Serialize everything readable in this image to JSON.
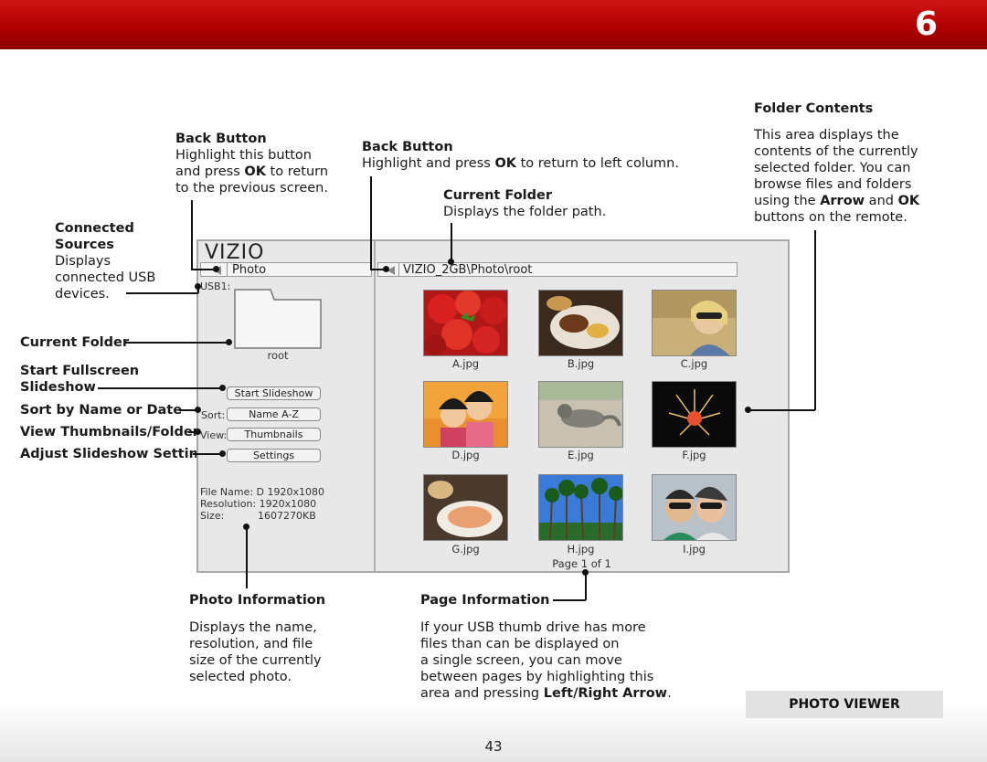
{
  "header": {
    "chapter": "6"
  },
  "annotations": {
    "back_button_left": {
      "title": "Back Button",
      "line1": "Highlight this button",
      "line2_pre": "and press ",
      "line2_bold": "OK",
      "line2_post": " to return",
      "line3": "to the previous screen."
    },
    "back_button_right": {
      "title": "Back Button",
      "pre": "Highlight and press ",
      "bold": "OK",
      "post": " to return to left column."
    },
    "current_folder_right": {
      "title": "Current Folder",
      "text": "Displays the folder path."
    },
    "folder_contents": {
      "title": "Folder Contents",
      "l1": "This area displays the",
      "l2": "contents of the currently",
      "l3": "selected folder. You can",
      "l4": "browse files and folders",
      "l5_pre": "using the ",
      "l5_b1": "Arrow",
      "l5_mid": " and ",
      "l5_b2": "OK",
      "l6": "buttons on the remote."
    },
    "connected_sources": {
      "title1": "Connected",
      "title2": "Sources",
      "l1": "Displays",
      "l2": "connected USB",
      "l3": "devices."
    },
    "current_folder_left": "Current Folder",
    "start_fullscreen1": "Start Fullscreen",
    "start_fullscreen2": "Slideshow",
    "sort_by": "Sort by Name or Date",
    "view_thumbnails": "View Thumbnails/Folders",
    "adjust_slideshow": "Adjust Slideshow Settings",
    "photo_information": {
      "title": "Photo Information",
      "l1": "Displays the name,",
      "l2": "resolution, and file",
      "l3": "size of the currently",
      "l4": "selected photo."
    },
    "page_information": {
      "title": "Page Information",
      "l1": "If your USB thumb drive has more",
      "l2": "files than can be displayed on",
      "l3": "a single screen, you can move",
      "l4": "between pages by highlighting this",
      "l5_pre": "area and pressing ",
      "l5_bold": "Left/Right Arrow",
      "l5_post": "."
    }
  },
  "screen": {
    "logo": "VIZIO",
    "left_path": "Photo",
    "right_path": "VIZIO_2GB\\Photo\\root",
    "usb_label": "USB1:",
    "folder_name": "root",
    "start_slideshow": "Start Slideshow",
    "sort_label": "Sort:",
    "sort_value": "Name A-Z",
    "view_label": "View:",
    "view_value": "Thumbnails",
    "settings": "Settings",
    "file_info": {
      "file_name": "File Name: D 1920x1080",
      "resolution": "Resolution: 1920x1080",
      "size_label": "Size:",
      "size_value": "1607270KB"
    },
    "thumbnails": [
      "A.jpg",
      "B.jpg",
      "C.jpg",
      "D.jpg",
      "E.jpg",
      "F.jpg",
      "G.jpg",
      "H.jpg",
      "I.jpg"
    ],
    "page_info": "Page 1 of 1"
  },
  "footer": {
    "section": "PHOTO VIEWER",
    "page_number": "43"
  }
}
